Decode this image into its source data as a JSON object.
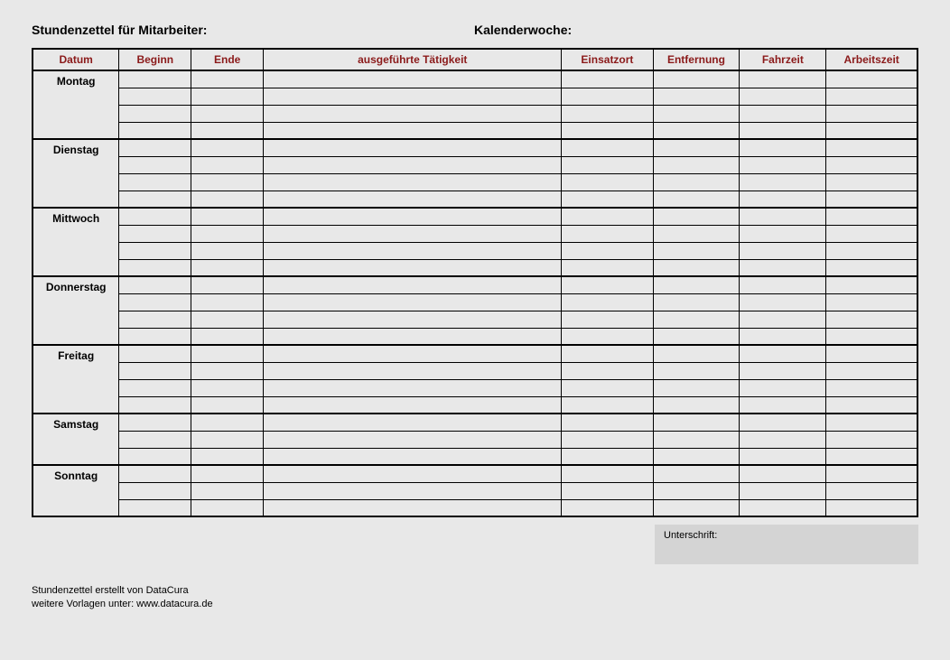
{
  "header": {
    "title_left": "Stundenzettel für Mitarbeiter:",
    "title_right": "Kalenderwoche:"
  },
  "columns": {
    "datum": "Datum",
    "beginn": "Beginn",
    "ende": "Ende",
    "taetigkeit": "ausgeführte Tätigkeit",
    "einsatzort": "Einsatzort",
    "entfernung": "Entfernung",
    "fahrzeit": "Fahrzeit",
    "arbeitszeit": "Arbeitszeit"
  },
  "days": [
    {
      "name": "Montag",
      "rows": 4
    },
    {
      "name": "Dienstag",
      "rows": 4
    },
    {
      "name": "Mittwoch",
      "rows": 4
    },
    {
      "name": "Donnerstag",
      "rows": 4
    },
    {
      "name": "Freitag",
      "rows": 4
    },
    {
      "name": "Samstag",
      "rows": 3
    },
    {
      "name": "Sonntag",
      "rows": 3
    }
  ],
  "signature": {
    "label": "Unterschrift:"
  },
  "footer": {
    "line1": "Stundenzettel erstellt von DataCura",
    "line2": "weitere Vorlagen unter: www.datacura.de"
  }
}
